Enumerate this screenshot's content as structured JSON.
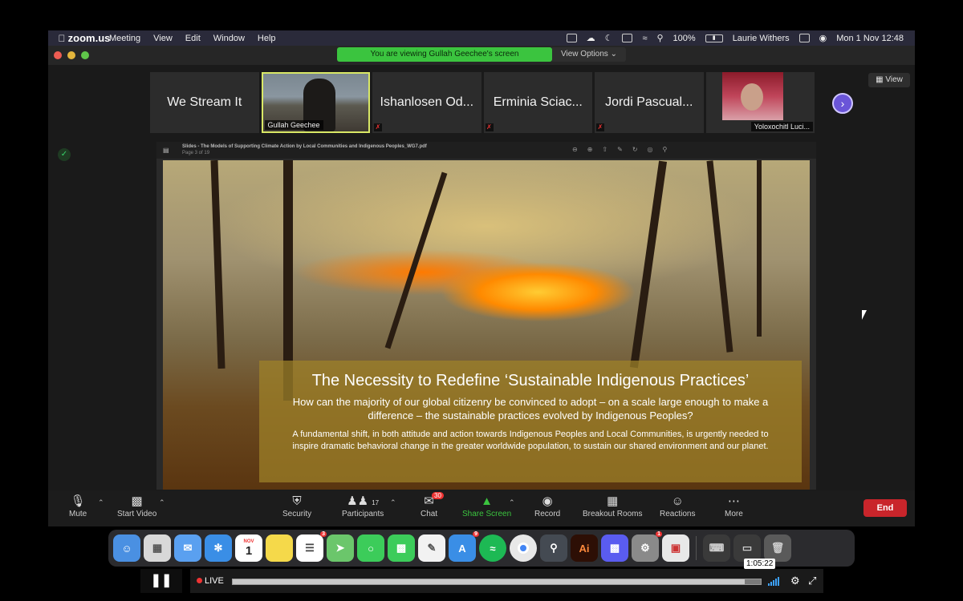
{
  "menubar": {
    "app_name": "zoom.us",
    "menus": [
      "Meeting",
      "View",
      "Edit",
      "Window",
      "Help"
    ],
    "battery": "100%",
    "user": "Laurie Withers",
    "datetime": "Mon 1 Nov  12:48"
  },
  "window": {
    "viewing_banner": "You are viewing Gullah Geechee's screen",
    "view_options": "View Options",
    "view_button": "View"
  },
  "participants": [
    {
      "name": "We Stream It"
    },
    {
      "name": "Gullah Geechee"
    },
    {
      "name": "Ishanlosen Od..."
    },
    {
      "name": "Erminia Sciac..."
    },
    {
      "name": "Jordi Pascual..."
    },
    {
      "name": "Yoloxochitl Luci..."
    }
  ],
  "pdf": {
    "title": "Slides - The Models of Supporting Climate Action by Local Communities and Indigenous Peoples_WG7.pdf",
    "page": "Page 3 of 19"
  },
  "slide": {
    "heading": "The Necessity to Redefine ‘Sustainable Indigenous Practices’",
    "question": "How can the majority of our global citizenry be convinced to adopt – on a scale large enough to make a difference – the sustainable practices evolved by Indigenous Peoples?",
    "statement": "A fundamental shift, in both attitude and action towards Indigenous Peoples and Local Communities, is urgently needed to inspire dramatic behavioral change in the greater worldwide population, to sustain our shared environment and our planet."
  },
  "toolbar": {
    "mute": "Mute",
    "start_video": "Start Video",
    "security": "Security",
    "participants": "Participants",
    "participants_count": "17",
    "chat": "Chat",
    "chat_badge": "30",
    "share_screen": "Share Screen",
    "record": "Record",
    "breakout": "Breakout Rooms",
    "reactions": "Reactions",
    "more": "More",
    "end": "End"
  },
  "dock": {
    "calendar_month": "NOV",
    "calendar_day": "1",
    "reminders_badge": "3",
    "appstore_badge": "9",
    "settings_badge": "1",
    "illustrator_label": "Ai",
    "apps": [
      {
        "name": "finder-icon",
        "color": "#4a90e2"
      },
      {
        "name": "launchpad-icon",
        "color": "#d8d8d8"
      },
      {
        "name": "mail-icon",
        "color": "#5aa0f0"
      },
      {
        "name": "safari-icon",
        "color": "#3a8ee6"
      },
      {
        "name": "calendar-icon",
        "color": "#ffffff"
      },
      {
        "name": "notes-icon",
        "color": "#f5d94a"
      },
      {
        "name": "reminders-icon",
        "color": "#ffffff"
      },
      {
        "name": "maps-icon",
        "color": "#6bc66b"
      },
      {
        "name": "messages-icon",
        "color": "#3ccc5a"
      },
      {
        "name": "facetime-icon",
        "color": "#3ccc5a"
      },
      {
        "name": "textedit-icon",
        "color": "#f2f2f2"
      },
      {
        "name": "appstore-icon",
        "color": "#3a8ee6"
      },
      {
        "name": "spotify-icon",
        "color": "#1db954"
      },
      {
        "name": "chrome-icon",
        "color": "#e8e8e8"
      },
      {
        "name": "quicktime-icon",
        "color": "#444a52"
      },
      {
        "name": "illustrator-icon",
        "color": "#2d0f05"
      },
      {
        "name": "zoom-icon",
        "color": "#5a5cf0"
      },
      {
        "name": "system-preferences-icon",
        "color": "#8a8a8a"
      },
      {
        "name": "photo-booth-icon",
        "color": "#e8e8e8"
      }
    ]
  },
  "player": {
    "live": "LIVE",
    "timestamp": "1:05:22",
    "progress": 0.97
  },
  "colors": {
    "banner_green": "#3bc43f",
    "end_red": "#c9252b",
    "accent_purple": "#6a55d8"
  }
}
